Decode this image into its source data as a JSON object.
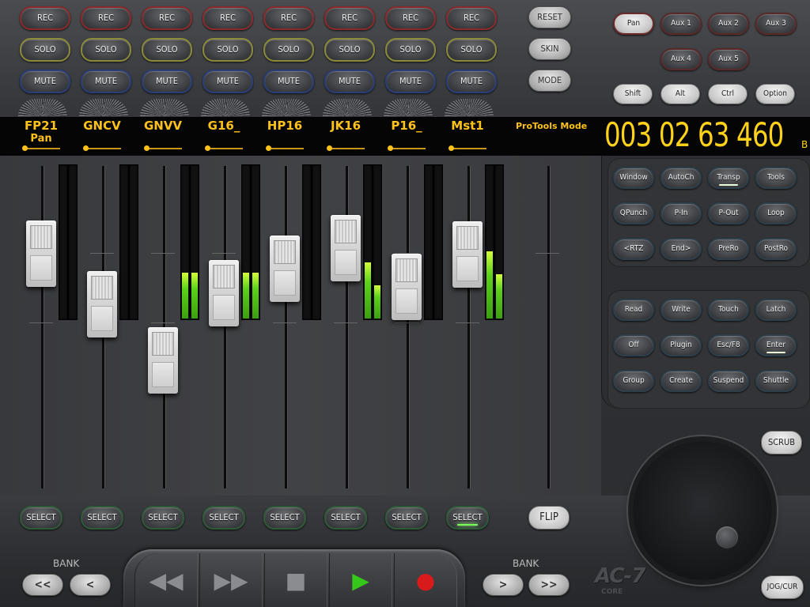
{
  "channels": {
    "rec_label": "REC",
    "solo_label": "SOLO",
    "mute_label": "MUTE",
    "select_label": "SELECT",
    "names": [
      "FP21",
      "GNCV",
      "GNVV",
      "G16_",
      "HP16",
      "JK16",
      "P16_",
      "Mst1"
    ],
    "sub_label": "Pan",
    "meter_levels": [
      0,
      0,
      0.3,
      0.3,
      0,
      0.37,
      0,
      0.44
    ],
    "meter_levels_b": [
      0,
      0,
      0.3,
      0.3,
      0,
      0.22,
      0,
      0.29
    ],
    "active_select_index": 7
  },
  "side_buttons": {
    "reset": "RESET",
    "skin": "SKIN",
    "mode": "MODE",
    "flip": "FLIP",
    "scrub": "SCRUB",
    "jog": "JOG/CUR"
  },
  "sends": {
    "pan": "Pan",
    "aux1": "Aux 1",
    "aux2": "Aux 2",
    "aux3": "Aux 3",
    "aux4": "Aux 4",
    "aux5": "Aux 5"
  },
  "modifiers": {
    "shift": "Shift",
    "alt": "Alt",
    "ctrl": "Ctrl",
    "option": "Option"
  },
  "display": {
    "mode": "ProTools Mode",
    "counter": "003 02 63 460",
    "counter_unit": "B"
  },
  "right_panel": {
    "group1": [
      "Window",
      "AutoCh",
      "Transp",
      "Tools",
      "QPunch",
      "P-In",
      "P-Out",
      "Loop",
      "<RTZ",
      "End>",
      "PreRo",
      "PostRo"
    ],
    "group2": [
      "Read",
      "Write",
      "Touch",
      "Latch",
      "Off",
      "Plugin",
      "Esc/F8",
      "Enter",
      "Group",
      "Create",
      "Suspend",
      "Shuttle"
    ]
  },
  "bank": {
    "label": "BANK",
    "prev_all": "<<",
    "prev": "<",
    "next": ">",
    "next_all": ">>"
  },
  "transport": {
    "rewind": "◀◀",
    "forward": "▶▶",
    "stop": "■",
    "play": "▶",
    "record": "●"
  },
  "brand": {
    "logo": "AC-7",
    "sub": "CORE"
  },
  "colors": {
    "display_text": "#ffc21a",
    "meter_green": "#5cd11a",
    "record_red": "#d81a1a",
    "play_green": "#35c81a"
  }
}
